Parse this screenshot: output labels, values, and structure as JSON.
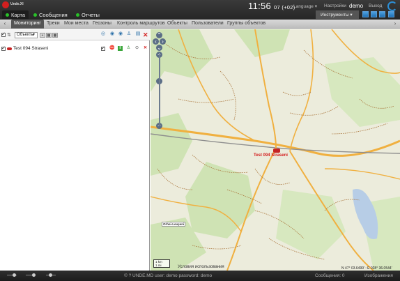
{
  "app": {
    "logo_text": "Unde.XI"
  },
  "nav": {
    "map": "Карта",
    "messages": "Сообщения",
    "reports": "Отчеты"
  },
  "header": {
    "time": "11:56",
    "seconds_tz": "07 (+02)",
    "language": "Language",
    "settings": "Настройки",
    "user": "demo",
    "logout": "Выход",
    "tools": "Инструменты"
  },
  "tabs": [
    "Мониторинг",
    "Треки",
    "Мои места",
    "Геозоны",
    "Контроль маршрутов",
    "Объекты",
    "Пользователи",
    "Группы объектов"
  ],
  "panel": {
    "select_value": "Объекты",
    "unit_name": "Test 094 Straseni"
  },
  "map": {
    "unit_label": "Test 094 Straseni",
    "town_label": "Orhei-Leuşeni",
    "scale_km": "1 km",
    "scale_mi": "1 mi",
    "terms": "Условия использования",
    "coords": "N 47° 03.6499' : E 028° 36.0544'"
  },
  "status": {
    "copyright": "© ? UNDE.MD user: demo password: demo",
    "messages": "Сообщения: 0",
    "images": "Изображения"
  },
  "colors": {
    "accent": "#2c8fd6",
    "unit_red": "#d31c1c",
    "forest": "#cfe3b4",
    "road_orange": "#f0b040"
  }
}
